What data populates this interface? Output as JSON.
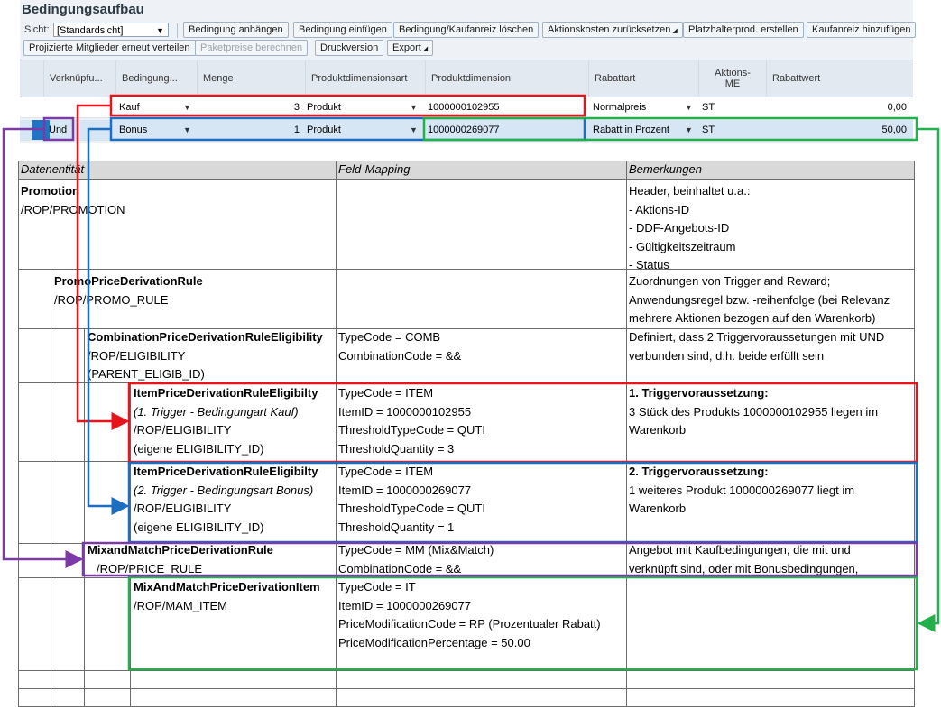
{
  "sap": {
    "title": "Bedingungsaufbau",
    "view_label": "Sicht:",
    "view_value": "[Standardsicht]",
    "toolbar1": [
      "Bedingung anhängen",
      "Bedingung einfügen",
      "Bedingung/Kaufanreiz löschen",
      "Aktionskosten zurücksetzen",
      "Platzhalterprod. erstellen",
      "Kaufanreiz hinzufügen"
    ],
    "toolbar2": [
      "Projizierte Mitglieder erneut verteilen",
      "Paketpreise berechnen",
      "Druckversion",
      "Export"
    ],
    "columns": [
      "Verknüpfu...",
      "Bedingung...",
      "Menge",
      "Produktdimensionsart",
      "Produktdimension",
      "Rabattart",
      "Aktions-ME",
      "Rabattwert"
    ],
    "rows": [
      {
        "link": "",
        "condition": "Kauf",
        "quantity": "3",
        "dim_type": "Produkt",
        "dimension": "1000000102955",
        "discount_type": "Normalpreis",
        "unit": "ST",
        "value": "0,00"
      },
      {
        "link": "Und",
        "condition": "Bonus",
        "quantity": "1",
        "dim_type": "Produkt",
        "dimension": "1000000269077",
        "discount_type": "Rabatt in Prozent",
        "unit": "ST",
        "value": "50,00"
      }
    ]
  },
  "doc": {
    "headers": [
      "Datenentität",
      "Feld-Mapping",
      "Bemerkungen"
    ],
    "rows": [
      {
        "entity": [
          "Promotion",
          "/ROP/PROMOTION"
        ],
        "mapping": [],
        "remarks": [
          "Header, beinhaltet u.a.:",
          "- Aktions-ID",
          "- DDF-Angebots-ID",
          "- Gültigkeitszeitraum",
          "- Status"
        ]
      },
      {
        "entity": [
          "PromoPriceDerivationRule",
          "/ROP/PROMO_RULE"
        ],
        "mapping": [],
        "remarks": [
          "Zuordnungen von Trigger and Reward;",
          "Anwendungsregel bzw. -reihenfolge (bei Relevanz",
          "mehrere Aktionen bezogen auf den Warenkorb)"
        ]
      },
      {
        "entity": [
          "CombinationPriceDerivationRuleEligibility",
          "/ROP/ELIGIBILITY",
          "(PARENT_ELIGIB_ID)"
        ],
        "mapping": [
          "TypeCode = COMB",
          "CombinationCode = &&"
        ],
        "remarks": [
          "Definiert, dass 2 Triggervoraussetungen mit UND",
          "verbunden sind, d.h. beide erfüllt sein"
        ]
      },
      {
        "entity": [
          "ItemPriceDerivationRuleEligibilty",
          "(1. Trigger - Bedingungart Kauf)",
          "/ROP/ELIGIBILITY",
          "(eigene ELIGIBILITY_ID)"
        ],
        "mapping": [
          "TypeCode = ITEM",
          "ItemID = 1000000102955",
          "ThresholdTypeCode = QUTI",
          "ThresholdQuantity = 3"
        ],
        "remarks": [
          "1. Triggervoraussetzung:",
          "3 Stück des Produkts 1000000102955 liegen im",
          "Warenkorb"
        ]
      },
      {
        "entity": [
          "ItemPriceDerivationRuleEligibilty",
          "(2. Trigger - Bedingungsart Bonus)",
          "/ROP/ELIGIBILITY",
          "(eigene ELIGIBILITY_ID)"
        ],
        "mapping": [
          "TypeCode = ITEM",
          "ItemID = 1000000269077",
          "ThresholdTypeCode = QUTI",
          "ThresholdQuantity = 1"
        ],
        "remarks": [
          "2. Triggervoraussetzung:",
          "1 weiteres Produkt 1000000269077 liegt im",
          "Warenkorb"
        ]
      },
      {
        "entity": [
          "MixandMatchPriceDerivationRule",
          "/ROP/PRICE_RULE"
        ],
        "mapping": [
          "TypeCode = MM (Mix&Match)",
          "CombinationCode = &&"
        ],
        "remarks": [
          "Angebot mit Kaufbedingungen, die mit und",
          "verknüpft sind, oder mit Bonusbedingungen,"
        ]
      },
      {
        "entity": [
          "MixAndMatchPriceDerivationItem",
          "/ROP/MAM_ITEM"
        ],
        "mapping": [
          "TypeCode = IT",
          "ItemID = 1000000269077",
          "PriceModificationCode = RP (Prozentualer Rabatt)",
          "PriceModificationPercentage = 50.00"
        ],
        "remarks": []
      }
    ]
  },
  "colors": {
    "red": "#e8141c",
    "blue": "#1c6fc0",
    "green": "#21b04b",
    "purple": "#7b3aa6"
  }
}
